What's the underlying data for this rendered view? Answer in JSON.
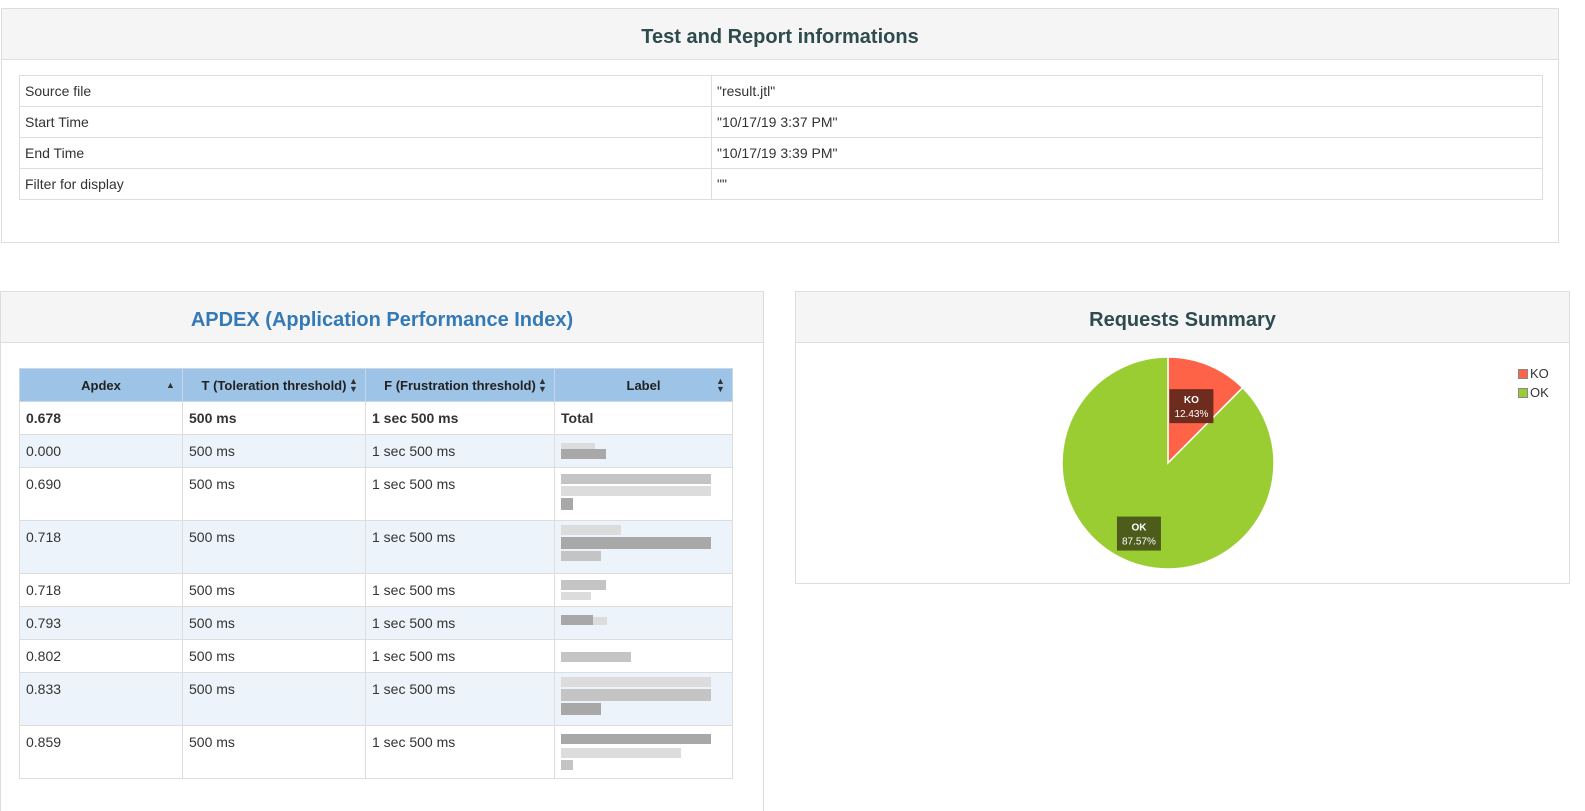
{
  "info": {
    "title": "Test and Report informations",
    "rows": [
      {
        "key": "Source file",
        "value": "\"result.jtl\""
      },
      {
        "key": "Start Time",
        "value": "\"10/17/19 3:37 PM\""
      },
      {
        "key": "End Time",
        "value": "\"10/17/19 3:39 PM\""
      },
      {
        "key": "Filter for display",
        "value": "\"\""
      }
    ]
  },
  "apdex": {
    "title": "APDEX (Application Performance Index)",
    "headers": [
      "Apdex",
      "T (Toleration threshold)",
      "F (Frustration threshold)",
      "Label"
    ],
    "total": {
      "apdex": "0.678",
      "t": "500 ms",
      "f": "1 sec 500 ms",
      "label": "Total"
    },
    "rows": [
      {
        "apdex": "0.000",
        "t": "500 ms",
        "f": "1 sec 500 ms"
      },
      {
        "apdex": "0.690",
        "t": "500 ms",
        "f": "1 sec 500 ms"
      },
      {
        "apdex": "0.718",
        "t": "500 ms",
        "f": "1 sec 500 ms"
      },
      {
        "apdex": "0.718",
        "t": "500 ms",
        "f": "1 sec 500 ms"
      },
      {
        "apdex": "0.793",
        "t": "500 ms",
        "f": "1 sec 500 ms"
      },
      {
        "apdex": "0.802",
        "t": "500 ms",
        "f": "1 sec 500 ms"
      },
      {
        "apdex": "0.833",
        "t": "500 ms",
        "f": "1 sec 500 ms"
      },
      {
        "apdex": "0.859",
        "t": "500 ms",
        "f": "1 sec 500 ms"
      }
    ]
  },
  "summary": {
    "title": "Requests Summary",
    "legend": [
      {
        "name": "KO",
        "color": "#ff6347"
      },
      {
        "name": "OK",
        "color": "#9acd32"
      }
    ]
  },
  "chart_data": {
    "type": "pie",
    "title": "Requests Summary",
    "slices": [
      {
        "name": "KO",
        "value": 12.43,
        "label": "KO",
        "pct": "12.43%",
        "color": "#ff6347"
      },
      {
        "name": "OK",
        "value": 87.57,
        "label": "OK",
        "pct": "87.57%",
        "color": "#9acd32"
      }
    ],
    "legend_position": "top-right"
  }
}
